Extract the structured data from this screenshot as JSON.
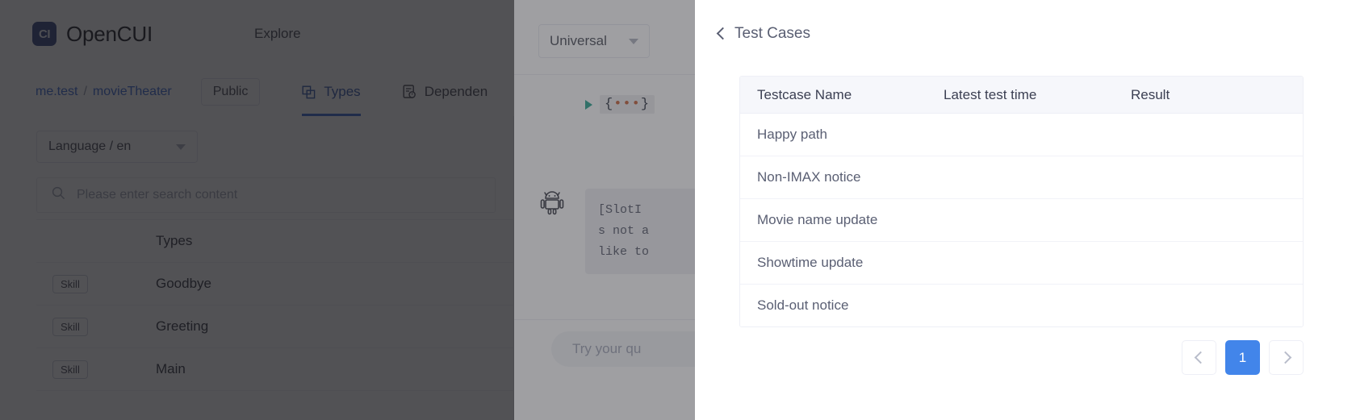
{
  "background_app": {
    "topbar": {
      "logo_mark": "CI",
      "logo_text": "OpenCUI",
      "explore_label": "Explore"
    },
    "subnav": {
      "breadcrumb_org": "me.test",
      "breadcrumb_sep": "/",
      "breadcrumb_project": "movieTheater",
      "visibility_label": "Public",
      "tabs": [
        {
          "label": "Types",
          "icon": "layers-icon",
          "active": true
        },
        {
          "label": "Dependen",
          "icon": "document-clock-icon",
          "active": false
        }
      ]
    },
    "left_pane": {
      "language_select_value": "Language / en",
      "search_placeholder": "Please enter search content",
      "table": {
        "columns": [
          "",
          "Types"
        ],
        "rows": [
          {
            "badge": "Skill",
            "name": "Goodbye"
          },
          {
            "badge": "Skill",
            "name": "Greeting"
          },
          {
            "badge": "Skill",
            "name": "Main"
          }
        ]
      }
    },
    "mid_pane": {
      "channel_select_value": "Universal",
      "code_fold_label": "{...}",
      "bot_message": "[SlotI\ns not a\nlike to",
      "input_placeholder": "Try your qu"
    }
  },
  "drawer": {
    "back_label": "Test Cases",
    "table": {
      "columns": [
        "Testcase Name",
        "Latest test time",
        "Result"
      ],
      "rows": [
        {
          "name": "Happy path",
          "latest_test_time": "",
          "result": ""
        },
        {
          "name": "Non-IMAX notice",
          "latest_test_time": "",
          "result": ""
        },
        {
          "name": "Movie name update",
          "latest_test_time": "",
          "result": ""
        },
        {
          "name": "Showtime update",
          "latest_test_time": "",
          "result": ""
        },
        {
          "name": "Sold-out notice",
          "latest_test_time": "",
          "result": ""
        }
      ]
    },
    "pagination": {
      "prev_label": "",
      "current_page": "1",
      "next_label": ""
    }
  },
  "colors": {
    "accent_blue": "#4285ea",
    "link_blue": "#2f5fd0",
    "brand_navy": "#2a3c78",
    "table_header_bg": "#f6f7fb"
  }
}
